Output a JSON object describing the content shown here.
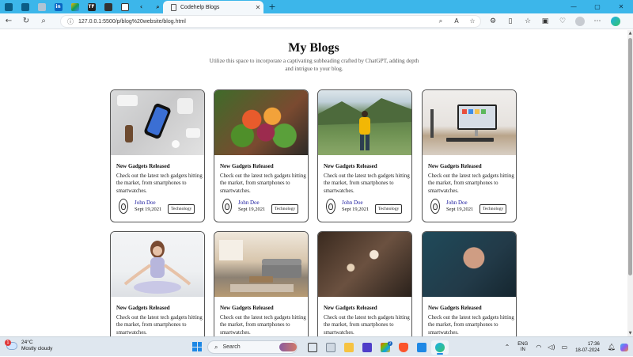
{
  "browser": {
    "tab_title": "Codehelp Blogs",
    "tab_close": "✕",
    "new_tab": "+",
    "url": "127.0.0.1:5500/p/blog%20website/blog.html",
    "window_controls": [
      "—",
      "▢",
      "✕"
    ]
  },
  "page": {
    "title": "My Blogs",
    "subtitle": "Utilize this space to incorporate a captivating subheading crafted by ChatGPT, adding depth and intrigue to your blog."
  },
  "cards": [
    {
      "title": "New Gadgets Released",
      "desc": "Check out the latest tech gadgets hitting the market, from smartphones to smartwatches.",
      "author": "John Doe",
      "date": "Sept 19,2021",
      "tag": "Technology",
      "image": "gadgets-photo"
    },
    {
      "title": "New Gadgets Released",
      "desc": "Check out the latest tech gadgets hitting the market, from smartphones to smartwatches.",
      "author": "John Doe",
      "date": "Sept 19,2021",
      "tag": "Technology",
      "image": "salad-photo"
    },
    {
      "title": "New Gadgets Released",
      "desc": "Check out the latest tech gadgets hitting the market, from smartphones to smartwatches.",
      "author": "John Doe",
      "date": "Sept 19,2021",
      "tag": "Technology",
      "image": "hiker-photo"
    },
    {
      "title": "New Gadgets Released",
      "desc": "Check out the latest tech gadgets hitting the market, from smartphones to smartwatches.",
      "author": "John Doe",
      "date": "Sept 19,2021",
      "tag": "Technology",
      "image": "desk-setup-photo"
    },
    {
      "title": "New Gadgets Released",
      "desc": "Check out the latest tech gadgets hitting the market, from smartphones to smartwatches.",
      "image": "yoga-photo"
    },
    {
      "title": "New Gadgets Released",
      "desc": "Check out the latest tech gadgets hitting the market, from smartphones to smartwatches.",
      "image": "living-room-photo"
    },
    {
      "title": "New Gadgets Released",
      "desc": "Check out the latest tech gadgets hitting the market, from smartphones to smartwatches.",
      "image": "flowers-photo"
    },
    {
      "title": "New Gadgets Released",
      "desc": "Check out the latest tech gadgets hitting the market, from smartphones to smartwatches.",
      "image": "thumbs-up-photo"
    }
  ],
  "taskbar": {
    "weather_temp": "24°C",
    "weather_desc": "Mostly cloudy",
    "weather_badge": "1",
    "search_label": "Search",
    "store_badge": "2",
    "lang_line1": "ENG",
    "lang_line2": "IN",
    "time": "17:36",
    "date": "18-07-2024"
  },
  "colors": {
    "tabstrip": "#3cb6ea",
    "author_link": "#1a1a9e",
    "taskbar": "#dfe7ef"
  }
}
